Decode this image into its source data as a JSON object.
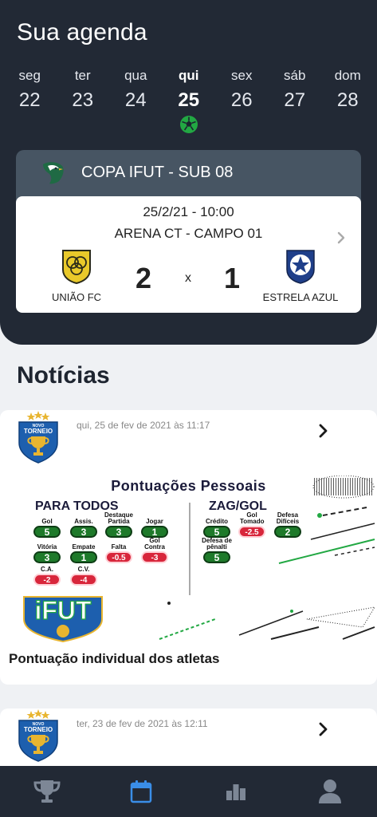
{
  "agenda": {
    "title": "Sua agenda",
    "days": [
      {
        "name": "seg",
        "num": "22"
      },
      {
        "name": "ter",
        "num": "23"
      },
      {
        "name": "qua",
        "num": "24"
      },
      {
        "name": "qui",
        "num": "25"
      },
      {
        "name": "sex",
        "num": "26"
      },
      {
        "name": "sáb",
        "num": "27"
      },
      {
        "name": "dom",
        "num": "28"
      }
    ],
    "selected_day": "25",
    "match_day_icon": "soccer-ball-icon"
  },
  "match": {
    "league": "COPA IFUT - SUB 08",
    "date": "25/2/21 - 10:00",
    "venue": "ARENA CT - CAMPO 01",
    "home_team": "UNIÃO FC",
    "away_team": "ESTRELA AZUL",
    "home_score": "2",
    "away_score": "1",
    "separator": "x"
  },
  "news": {
    "title": "Notícias",
    "items": [
      {
        "time": "qui, 25 de fev de 2021 às 11:17",
        "headline": "Pontuação individual dos atletas",
        "image": {
          "title": "Pontuações Pessoais",
          "para_todos_label": "PARA TODOS",
          "zag_gol_label": "ZAG/GOL",
          "logo_text": "iFUT",
          "para_todos": [
            {
              "label": "Gol",
              "value": "5"
            },
            {
              "label": "Assis.",
              "value": "3"
            },
            {
              "label": "Destaque Partida",
              "value": "3"
            },
            {
              "label": "Jogar",
              "value": "1"
            },
            {
              "label": "Vitória",
              "value": "3"
            },
            {
              "label": "Empate",
              "value": "1"
            },
            {
              "label": "Falta",
              "value": "-0.5"
            },
            {
              "label": "Gol Contra",
              "value": "-3"
            },
            {
              "label": "C.A.",
              "value": "-2"
            },
            {
              "label": "C.V.",
              "value": "-4"
            }
          ],
          "zag_gol": [
            {
              "label": "Crédito",
              "value": "5"
            },
            {
              "label": "Gol Tomado",
              "value": "-2.5"
            },
            {
              "label": "Defesa Difíceis",
              "value": "2"
            },
            {
              "label": "Defesa de pênalti",
              "value": "5"
            }
          ]
        }
      },
      {
        "time": "ter, 23 de fev de 2021 às 12:11",
        "headline": ""
      }
    ],
    "logo_text": "NOVO TORNEIO"
  },
  "nav": [
    {
      "name": "trophy-icon",
      "active": false
    },
    {
      "name": "calendar-icon",
      "active": true
    },
    {
      "name": "ranking-icon",
      "active": false
    },
    {
      "name": "profile-icon",
      "active": false
    }
  ],
  "colors": {
    "header_bg": "#222935",
    "league_bar": "#475563",
    "accent_green": "#22a843",
    "nav_active": "#3a8ee8",
    "nav_inactive": "#7d8796"
  }
}
